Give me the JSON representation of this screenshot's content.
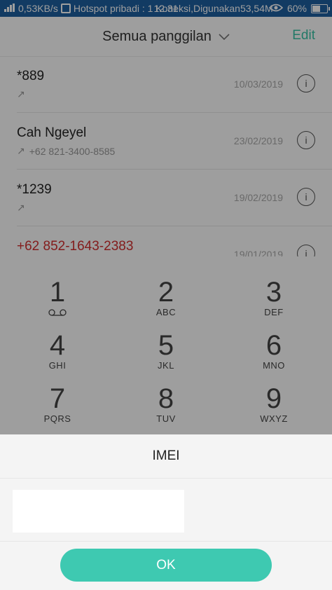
{
  "statusbar": {
    "speed": "0,53KB/s",
    "hotspot": "Hotspot pribadi : 1 Koneksi,Digunakan53,54M",
    "time": "12.31",
    "battery": "60%",
    "battery_level": 0.6
  },
  "header": {
    "title": "Semua panggilan",
    "edit": "Edit"
  },
  "calls": [
    {
      "name": "*889",
      "number": "",
      "date": "10/03/2019",
      "missed": false
    },
    {
      "name": "Cah Ngeyel",
      "number": "+62 821-3400-8585",
      "date": "23/02/2019",
      "missed": false
    },
    {
      "name": "*1239",
      "number": "",
      "date": "19/02/2019",
      "missed": false
    },
    {
      "name": "+62 852-1643-2383",
      "number": "",
      "date": "19/01/2019",
      "missed": true
    }
  ],
  "dialpad": {
    "keys": [
      {
        "num": "1",
        "letters": ""
      },
      {
        "num": "2",
        "letters": "ABC"
      },
      {
        "num": "3",
        "letters": "DEF"
      },
      {
        "num": "4",
        "letters": "GHI"
      },
      {
        "num": "5",
        "letters": "JKL"
      },
      {
        "num": "6",
        "letters": "MNO"
      },
      {
        "num": "7",
        "letters": "PQRS"
      },
      {
        "num": "8",
        "letters": "TUV"
      },
      {
        "num": "9",
        "letters": "WXYZ"
      }
    ]
  },
  "dialog": {
    "title": "IMEI",
    "value": "",
    "ok": "OK"
  },
  "colors": {
    "accent": "#3ec9b1",
    "statusbar": "#1e5fa0",
    "missed": "#d32f2f"
  }
}
